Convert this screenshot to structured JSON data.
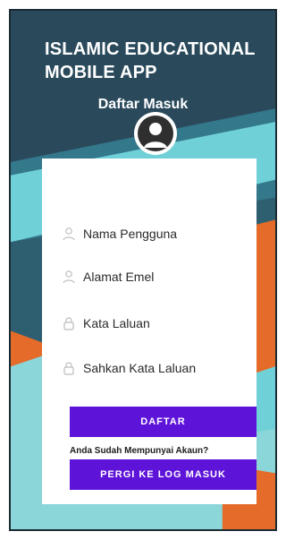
{
  "app": {
    "title_line1": "ISLAMIC EDUCATIONAL",
    "title_line2": "MOBILE APP",
    "subtitle": "Daftar Masuk"
  },
  "form": {
    "fields": [
      {
        "label": "Nama Pengguna",
        "icon": "user-icon"
      },
      {
        "label": "Alamat Emel",
        "icon": "user-icon"
      },
      {
        "label": "Kata Laluan",
        "icon": "lock-icon"
      },
      {
        "label": "Sahkan Kata Laluan",
        "icon": "lock-icon"
      }
    ],
    "register_button": "DAFTAR",
    "have_account_text": "Anda Sudah Mempunyai Akaun?",
    "login_button": "PERGI KE LOG MASUK"
  },
  "colors": {
    "primary": "#5e13d9",
    "background_dark": "#2a4a5c",
    "accent_teal": "#6fd0d8",
    "accent_orange": "#e46b2a"
  }
}
